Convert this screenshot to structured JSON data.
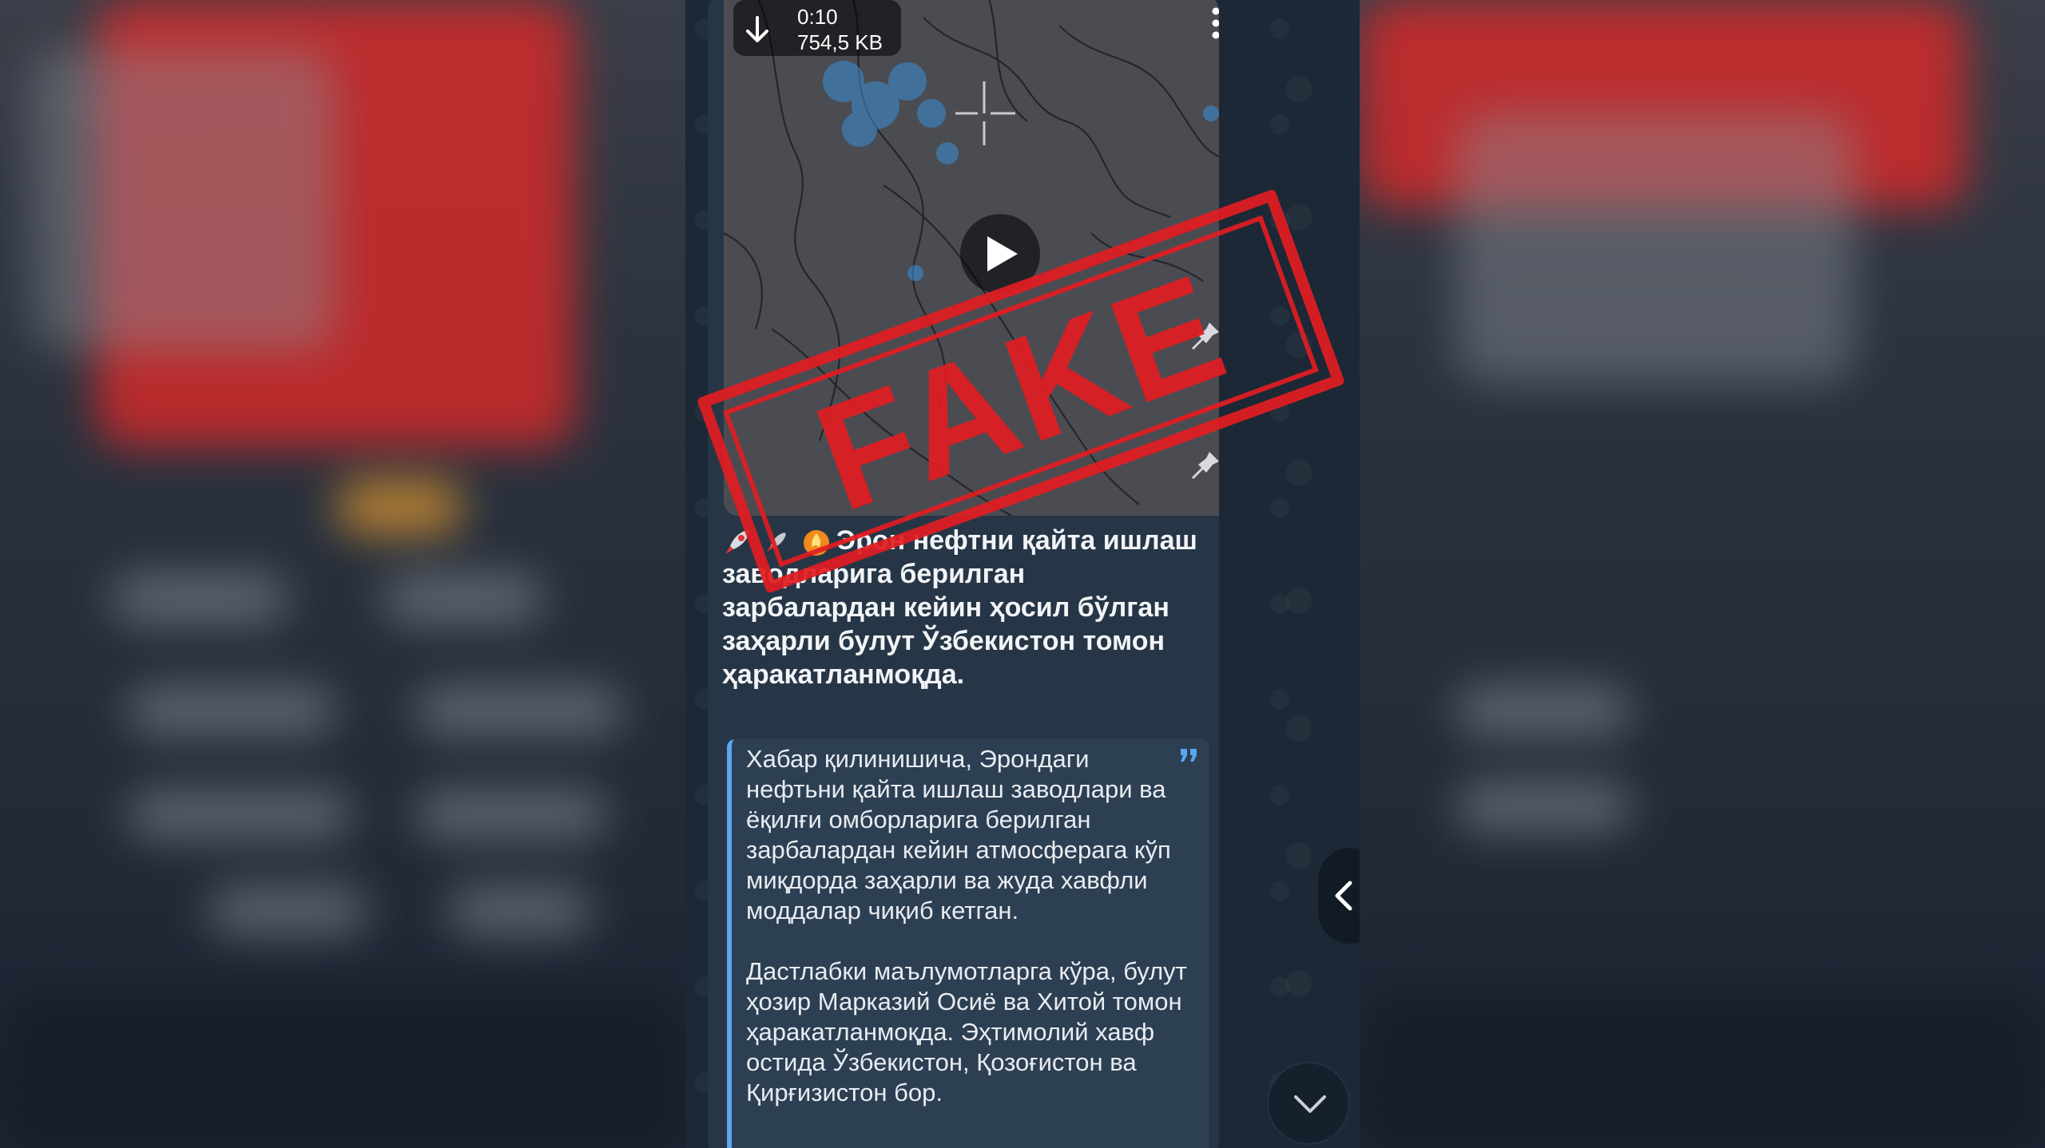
{
  "video": {
    "duration": "0:10",
    "size": "754,5 KB"
  },
  "message": {
    "headline": "Эрон нефтни қайта ишлаш заводларига берилган зарбалардан кейин ҳосил бўлган заҳарли булут Ўзбекистон томон ҳаракатланмоқда.",
    "quote_paragraphs": [
      "Хабар қилинишича, Эрондаги нефтьни қайта ишлаш заводлари ва ёқилғи омборларига берилган зарбалардан кейин атмосферага кўп миқдорда заҳарли ва жуда хавфли моддалар чиқиб кетган.",
      "Дастлабки маълумотларга кўра, булут ҳозир Марказий Осиё ва Хитой томон ҳаракатланмоқда. Эҳтимолий хавф остида Ўзбекистон, Қозоғистон ва Қирғизистон бор."
    ]
  },
  "stamp": {
    "text": "FAKE",
    "color": "#e01d22"
  },
  "colors": {
    "bubble": "#273646",
    "quote_bar": "#5aa7ef",
    "quote_bg": "#2d3f52",
    "text": "#f2f4f7"
  },
  "icons": [
    "download-arrow-icon",
    "more-vertical-icon",
    "play-icon",
    "pin-icon",
    "rocket-icon",
    "fire-icon",
    "quote-icon",
    "chevron-left-icon",
    "chevron-down-icon"
  ]
}
